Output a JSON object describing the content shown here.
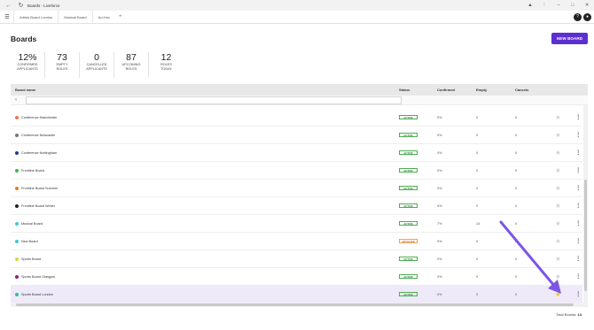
{
  "window": {
    "title": "Boards - Liveforce",
    "back_icon": "back-arrow-icon",
    "reload_icon": "reload-icon",
    "extensions_icon": "puzzle-icon",
    "more_icon": "vertical-dots-icon",
    "controls": [
      "–",
      "□",
      "✕"
    ]
  },
  "tabs": [
    {
      "label": "Artists Board London"
    },
    {
      "label": "Musical Board"
    },
    {
      "label": "Ad-Hoc"
    }
  ],
  "tab_add_label": "+",
  "help_label": "?",
  "page_title": "Boards",
  "new_board_label": "NEW BOARD",
  "stats": [
    {
      "value": "12%",
      "label_line1": "CONFIRMED",
      "label_line2": "APPLICANTS"
    },
    {
      "value": "73",
      "label_line1": "EMPTY",
      "label_line2": "ROLES"
    },
    {
      "value": "0",
      "label_line1": "CANCELLED",
      "label_line2": "APPLICANTS"
    },
    {
      "value": "87",
      "label_line1": "UPCOMING",
      "label_line2": "ROLES"
    },
    {
      "value": "12",
      "label_line1": "ROLES",
      "label_line2": "TODAY"
    }
  ],
  "table": {
    "columns": {
      "name": "Board name",
      "status": "Status",
      "confirmed": "Confirmed",
      "empty": "Empty",
      "cancels": "Cancels"
    },
    "rows": [
      {
        "name": "Conference Manchester",
        "color": "#e8735a",
        "status": "ACTIVE",
        "status_type": "active",
        "confirmed": "0%",
        "empty": "0",
        "cancels": "0",
        "starred": false
      },
      {
        "name": "Conference Newcastle",
        "color": "#777777",
        "status": "ACTIVE",
        "status_type": "active",
        "confirmed": "0%",
        "empty": "0",
        "cancels": "0",
        "starred": false
      },
      {
        "name": "Conference Nottingham",
        "color": "#1f3f8f",
        "status": "ACTIVE",
        "status_type": "active",
        "confirmed": "0%",
        "empty": "0",
        "cancels": "0",
        "starred": false
      },
      {
        "name": "Frontline Board",
        "color": "#3fb54a",
        "status": "ACTIVE",
        "status_type": "active",
        "confirmed": "0%",
        "empty": "0",
        "cancels": "0",
        "starred": false
      },
      {
        "name": "Frontline Board Summer",
        "color": "#e67e22",
        "status": "ACTIVE",
        "status_type": "active",
        "confirmed": "0%",
        "empty": "0",
        "cancels": "0",
        "starred": false
      },
      {
        "name": "Frontline Board Winter",
        "color": "#222222",
        "status": "ACTIVE",
        "status_type": "active",
        "confirmed": "0%",
        "empty": "0",
        "cancels": "0",
        "starred": false
      },
      {
        "name": "Musical Board",
        "color": "#3fc8d8",
        "status": "ACTIVE",
        "status_type": "active",
        "confirmed": "7%",
        "empty": "14",
        "cancels": "0",
        "starred": false
      },
      {
        "name": "New Board",
        "color": "#3fc8d8",
        "status": "ARCHIVED",
        "status_type": "archived",
        "confirmed": "0%",
        "empty": "0",
        "cancels": "0",
        "starred": false
      },
      {
        "name": "Sports Board",
        "color": "#d4d840",
        "status": "ACTIVE",
        "status_type": "active",
        "confirmed": "0%",
        "empty": "0",
        "cancels": "0",
        "starred": false
      },
      {
        "name": "Sports Board Glasgow",
        "color": "#8e2470",
        "status": "ACTIVE",
        "status_type": "active",
        "confirmed": "0%",
        "empty": "0",
        "cancels": "0",
        "starred": false
      },
      {
        "name": "Sports Board London",
        "color": "#2ec48a",
        "status": "ACTIVE",
        "status_type": "active",
        "confirmed": "0%",
        "empty": "0",
        "cancels": "0",
        "starred": true
      }
    ]
  },
  "footer": {
    "total_label": "Total Boards:",
    "total_value": "14"
  },
  "colors": {
    "accent": "#5b2fd1",
    "star_on": "#f5c518",
    "arrow": "#7b55e6"
  }
}
